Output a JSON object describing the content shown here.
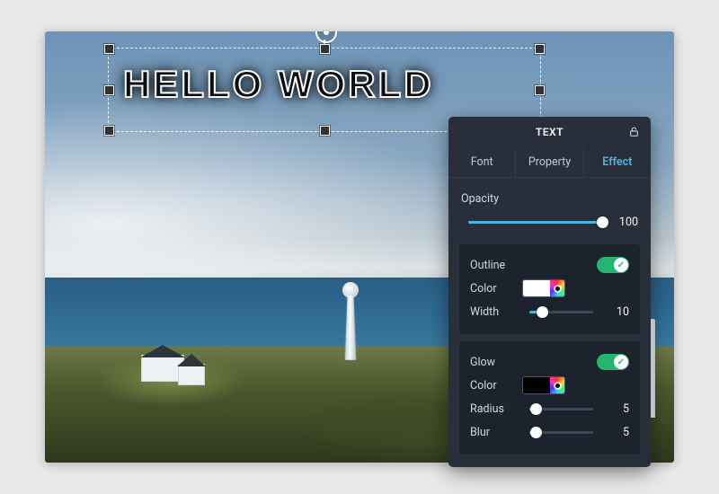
{
  "text_object": {
    "content": "HELLO WORLD"
  },
  "panel": {
    "title": "TEXT",
    "tabs": {
      "font": "Font",
      "property": "Property",
      "effect": "Effect",
      "active": "effect"
    },
    "opacity": {
      "label": "Opacity",
      "value": 100,
      "max": 100
    },
    "outline": {
      "label": "Outline",
      "enabled": true,
      "color_label": "Color",
      "color": "#ffffff",
      "width_label": "Width",
      "width": 10,
      "width_max": 50
    },
    "glow": {
      "label": "Glow",
      "enabled": true,
      "color_label": "Color",
      "color": "#000000",
      "radius_label": "Radius",
      "radius": 5,
      "radius_max": 50,
      "blur_label": "Blur",
      "blur": 5,
      "blur_max": 50
    }
  }
}
